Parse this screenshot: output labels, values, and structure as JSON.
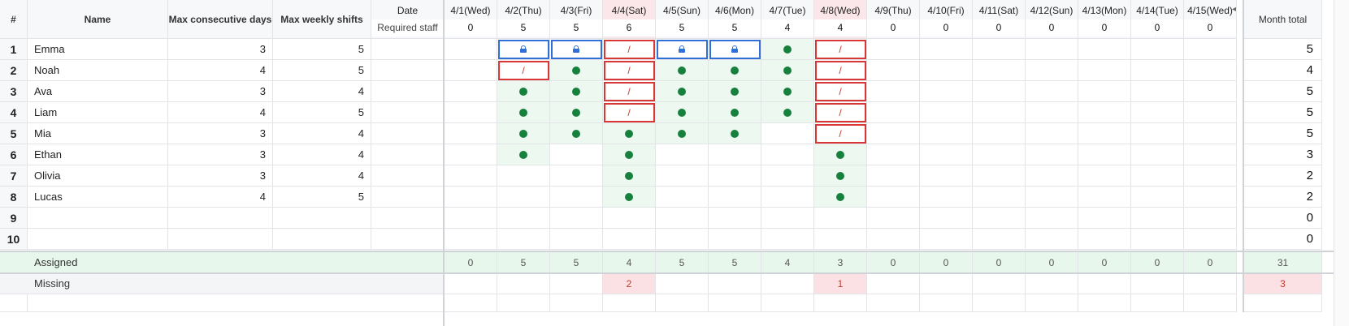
{
  "header": {
    "index": "#",
    "name": "Name",
    "max_consecutive": "Max consecutive days",
    "max_weekly": "Max weekly shifts",
    "date_label": "Date",
    "required_label": "Required staff",
    "month_total": "Month total"
  },
  "dates": [
    {
      "label": "4/1(Wed)",
      "required": "0",
      "weekend": false
    },
    {
      "label": "4/2(Thu)",
      "required": "5",
      "weekend": false
    },
    {
      "label": "4/3(Fri)",
      "required": "5",
      "weekend": false
    },
    {
      "label": "4/4(Sat)",
      "required": "6",
      "weekend": true
    },
    {
      "label": "4/5(Sun)",
      "required": "5",
      "weekend": false
    },
    {
      "label": "4/6(Mon)",
      "required": "5",
      "weekend": false
    },
    {
      "label": "4/7(Tue)",
      "required": "4",
      "weekend": false
    },
    {
      "label": "4/8(Wed)",
      "required": "4",
      "weekend": true
    },
    {
      "label": "4/9(Thu)",
      "required": "0",
      "weekend": false
    },
    {
      "label": "4/10(Fri)",
      "required": "0",
      "weekend": false
    },
    {
      "label": "4/11(Sat)",
      "required": "0",
      "weekend": false
    },
    {
      "label": "4/12(Sun)",
      "required": "0",
      "weekend": false
    },
    {
      "label": "4/13(Mon)",
      "required": "0",
      "weekend": false
    },
    {
      "label": "4/14(Tue)",
      "required": "0",
      "weekend": false
    },
    {
      "label": "4/15(Wed)",
      "required": "0",
      "weekend": false
    }
  ],
  "staff": [
    {
      "index": "1",
      "name": "Emma",
      "max_consecutive": "3",
      "max_weekly": "5",
      "total": "5",
      "shifts": [
        "",
        "L",
        "L",
        "X",
        "L",
        "L",
        "O",
        "X",
        "",
        "",
        "",
        "",
        "",
        "",
        ""
      ]
    },
    {
      "index": "2",
      "name": "Noah",
      "max_consecutive": "4",
      "max_weekly": "5",
      "total": "4",
      "shifts": [
        "",
        "X",
        "O",
        "X",
        "O",
        "O",
        "O",
        "X",
        "",
        "",
        "",
        "",
        "",
        "",
        ""
      ]
    },
    {
      "index": "3",
      "name": "Ava",
      "max_consecutive": "3",
      "max_weekly": "4",
      "total": "5",
      "shifts": [
        "",
        "O",
        "O",
        "X",
        "O",
        "O",
        "O",
        "X",
        "",
        "",
        "",
        "",
        "",
        "",
        ""
      ]
    },
    {
      "index": "4",
      "name": "Liam",
      "max_consecutive": "4",
      "max_weekly": "5",
      "total": "5",
      "shifts": [
        "",
        "O",
        "O",
        "X",
        "O",
        "O",
        "O",
        "X",
        "",
        "",
        "",
        "",
        "",
        "",
        ""
      ]
    },
    {
      "index": "5",
      "name": "Mia",
      "max_consecutive": "3",
      "max_weekly": "4",
      "total": "5",
      "shifts": [
        "",
        "O",
        "O",
        "O",
        "O",
        "O",
        "",
        "X",
        "",
        "",
        "",
        "",
        "",
        "",
        ""
      ]
    },
    {
      "index": "6",
      "name": "Ethan",
      "max_consecutive": "3",
      "max_weekly": "4",
      "total": "3",
      "shifts": [
        "",
        "O",
        "",
        "O",
        "",
        "",
        "",
        "O",
        "",
        "",
        "",
        "",
        "",
        "",
        ""
      ]
    },
    {
      "index": "7",
      "name": "Olivia",
      "max_consecutive": "3",
      "max_weekly": "4",
      "total": "2",
      "shifts": [
        "",
        "",
        "",
        "O",
        "",
        "",
        "",
        "O",
        "",
        "",
        "",
        "",
        "",
        "",
        ""
      ]
    },
    {
      "index": "8",
      "name": "Lucas",
      "max_consecutive": "4",
      "max_weekly": "5",
      "total": "2",
      "shifts": [
        "",
        "",
        "",
        "O",
        "",
        "",
        "",
        "O",
        "",
        "",
        "",
        "",
        "",
        "",
        ""
      ]
    },
    {
      "index": "9",
      "name": "",
      "max_consecutive": "",
      "max_weekly": "",
      "total": "0",
      "shifts": [
        "",
        "",
        "",
        "",
        "",
        "",
        "",
        "",
        "",
        "",
        "",
        "",
        "",
        "",
        ""
      ]
    },
    {
      "index": "10",
      "name": "",
      "max_consecutive": "",
      "max_weekly": "",
      "total": "0",
      "shifts": [
        "",
        "",
        "",
        "",
        "",
        "",
        "",
        "",
        "",
        "",
        "",
        "",
        "",
        "",
        ""
      ]
    }
  ],
  "assigned": {
    "label": "Assigned",
    "values": [
      "0",
      "5",
      "5",
      "4",
      "5",
      "5",
      "4",
      "3",
      "0",
      "0",
      "0",
      "0",
      "0",
      "0",
      "0"
    ],
    "total": "31"
  },
  "missing": {
    "label": "Missing",
    "values": [
      "",
      "",
      "",
      "2",
      "",
      "",
      "",
      "1",
      "",
      "",
      "",
      "",
      "",
      "",
      ""
    ],
    "total": "3"
  },
  "colors": {
    "assigned_dot": "#17803d",
    "locked_border": "#2f6fd6",
    "conflict_border": "#d93636",
    "weekend_header": "#fbe7e9",
    "assigned_row": "#e8f7ec",
    "missing_highlight": "#fbe1e3"
  },
  "icons": {
    "locked": "lock-icon",
    "assigned": "dot-icon",
    "unavailable": "slash-icon"
  },
  "legend_symbols": {
    "unavailable": "/"
  }
}
